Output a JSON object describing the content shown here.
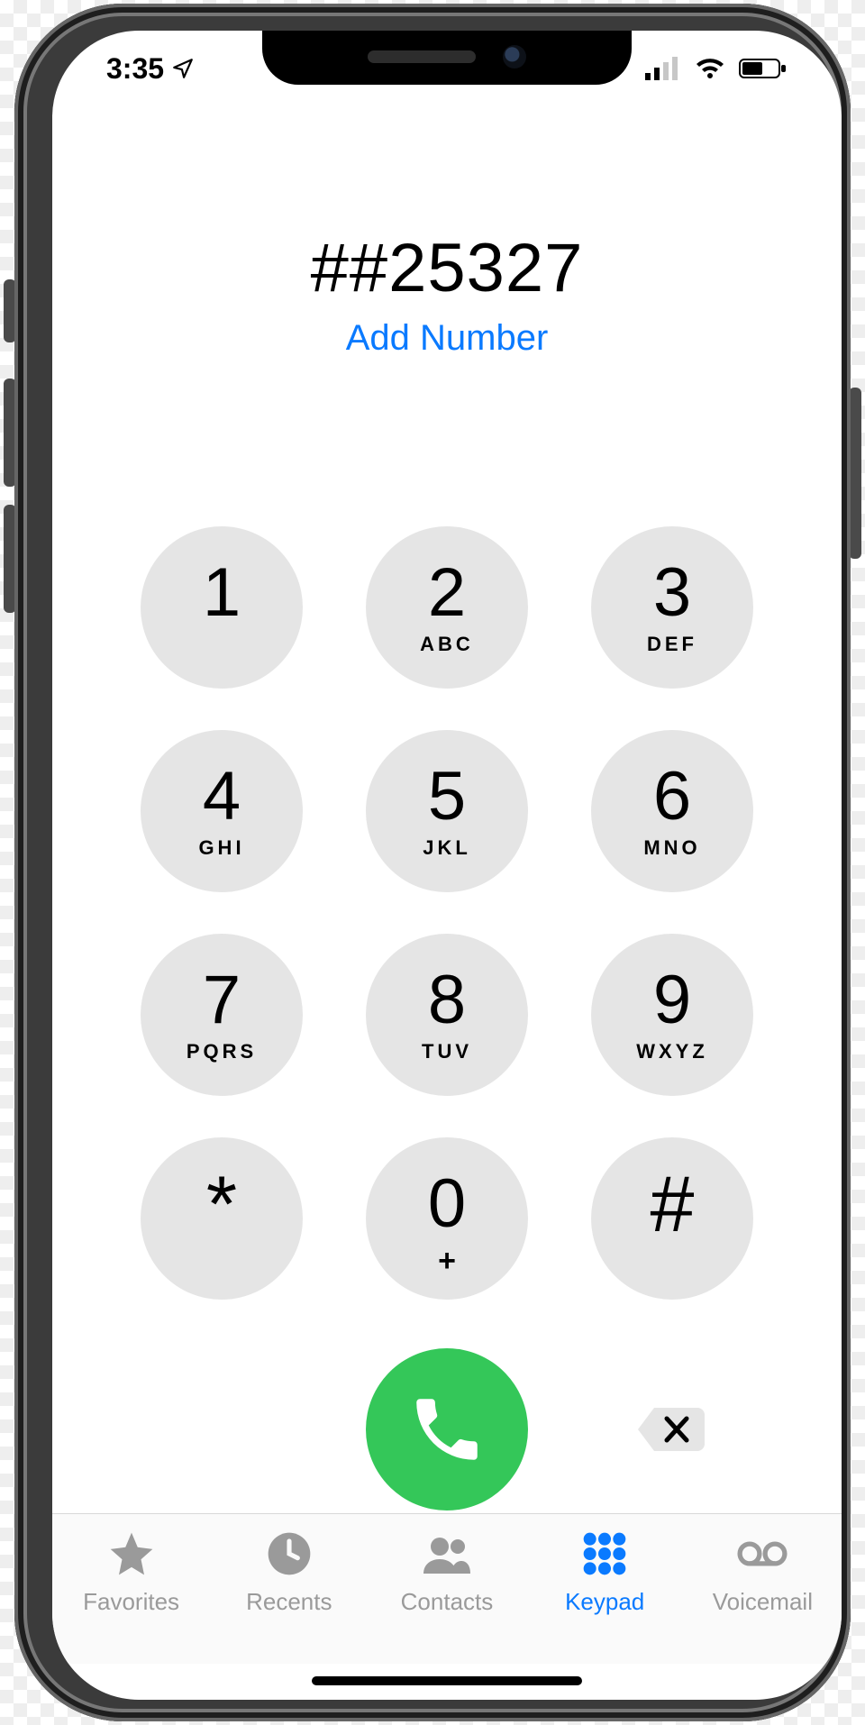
{
  "statusbar": {
    "time": "3:35"
  },
  "dialer": {
    "number": "##25327",
    "add_number_label": "Add Number"
  },
  "keypad": [
    {
      "digit": "1",
      "letters": ""
    },
    {
      "digit": "2",
      "letters": "ABC"
    },
    {
      "digit": "3",
      "letters": "DEF"
    },
    {
      "digit": "4",
      "letters": "GHI"
    },
    {
      "digit": "5",
      "letters": "JKL"
    },
    {
      "digit": "6",
      "letters": "MNO"
    },
    {
      "digit": "7",
      "letters": "PQRS"
    },
    {
      "digit": "8",
      "letters": "TUV"
    },
    {
      "digit": "9",
      "letters": "WXYZ"
    },
    {
      "digit": "*",
      "letters": ""
    },
    {
      "digit": "0",
      "letters": "+"
    },
    {
      "digit": "#",
      "letters": ""
    }
  ],
  "tabs": {
    "favorites": "Favorites",
    "recents": "Recents",
    "contacts": "Contacts",
    "keypad": "Keypad",
    "voicemail": "Voicemail"
  }
}
